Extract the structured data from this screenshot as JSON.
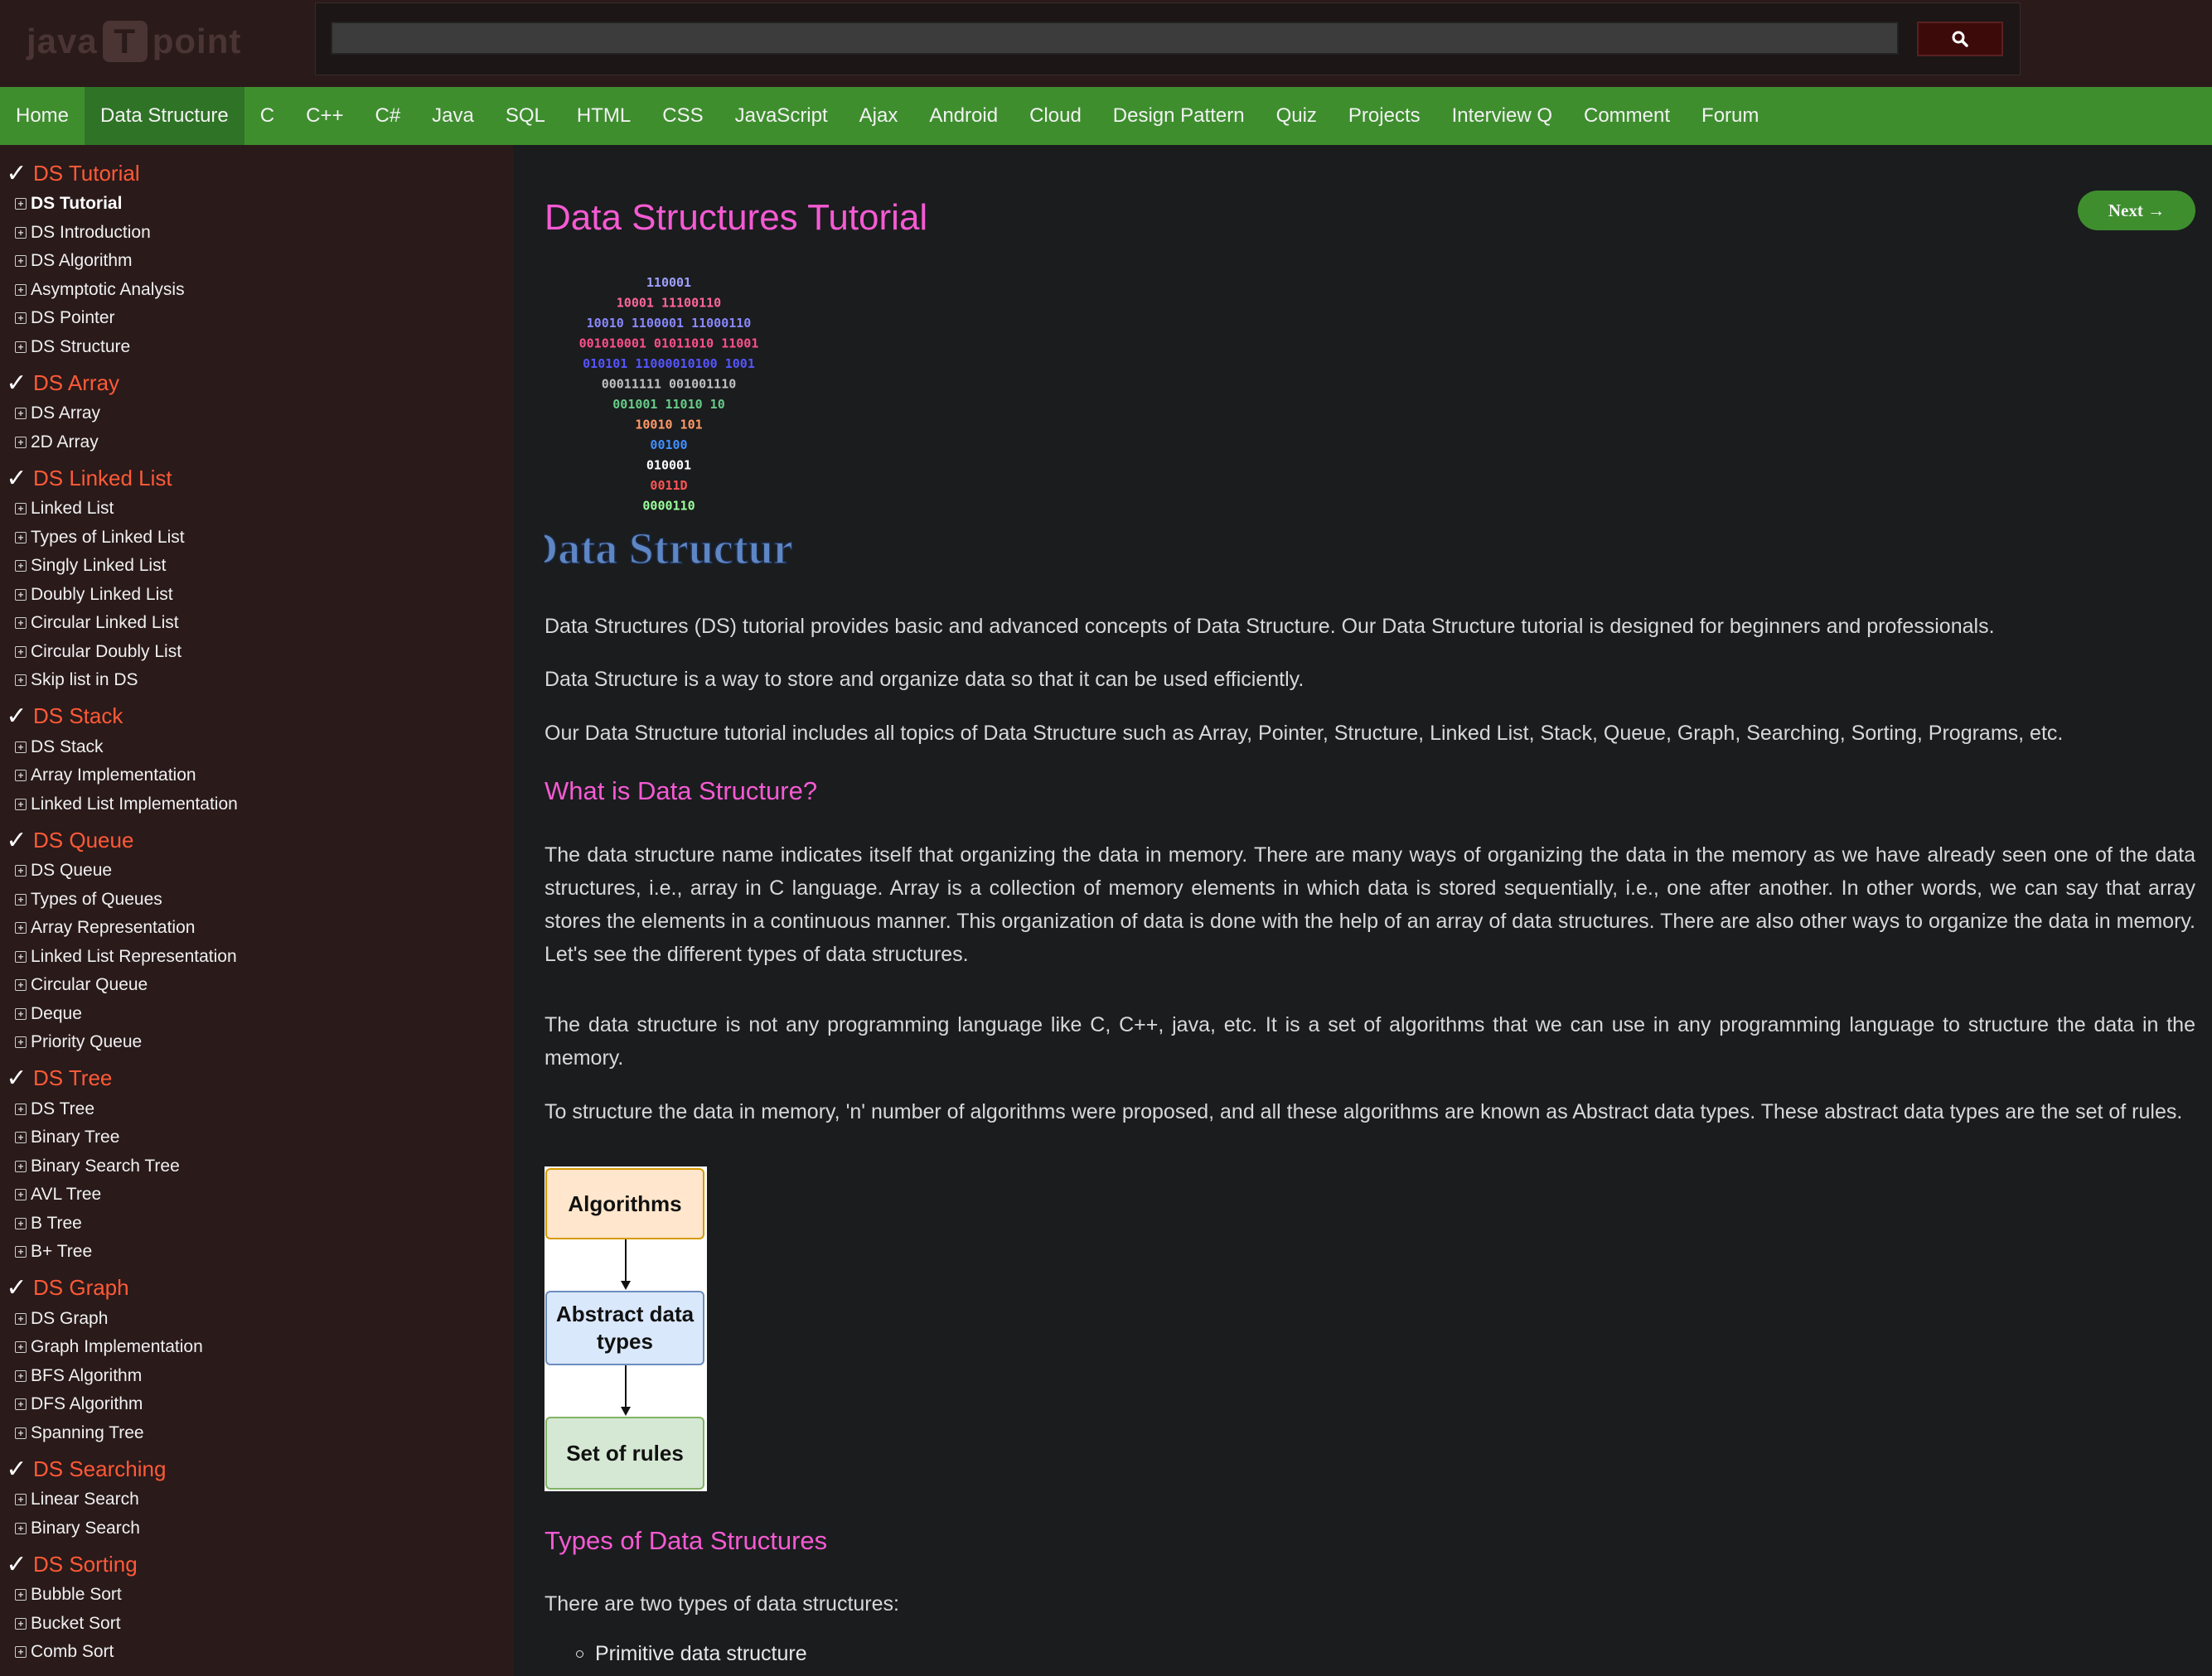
{
  "header": {
    "logo_left": "java",
    "logo_mark": "T",
    "logo_right": "point",
    "search_value": "",
    "search_icon": "search-icon"
  },
  "nav": {
    "items": [
      "Home",
      "Data Structure",
      "C",
      "C++",
      "C#",
      "Java",
      "SQL",
      "HTML",
      "CSS",
      "JavaScript",
      "Ajax",
      "Android",
      "Cloud",
      "Design Pattern",
      "Quiz",
      "Projects",
      "Interview Q",
      "Comment",
      "Forum"
    ],
    "active": "Data Structure",
    "bar_color": "#3e8e2e"
  },
  "sidebar": {
    "sections": [
      {
        "title": "DS Tutorial",
        "links": [
          "DS Tutorial",
          "DS Introduction",
          "DS Algorithm",
          "Asymptotic Analysis",
          "DS Pointer",
          "DS Structure"
        ]
      },
      {
        "title": "DS Array",
        "links": [
          "DS Array",
          "2D Array"
        ]
      },
      {
        "title": "DS Linked List",
        "links": [
          "Linked List",
          "Types of Linked List",
          "Singly Linked List",
          "Doubly Linked List",
          "Circular Linked List",
          "Circular Doubly List",
          "Skip list in DS"
        ]
      },
      {
        "title": "DS Stack",
        "links": [
          "DS Stack",
          "Array Implementation",
          "Linked List Implementation"
        ]
      },
      {
        "title": "DS Queue",
        "links": [
          "DS Queue",
          "Types of Queues",
          "Array Representation",
          "Linked List Representation",
          "Circular Queue",
          "Deque",
          "Priority Queue"
        ]
      },
      {
        "title": "DS Tree",
        "links": [
          "DS Tree",
          "Binary Tree",
          "Binary Search Tree",
          "AVL Tree",
          "B Tree",
          "B+ Tree"
        ]
      },
      {
        "title": "DS Graph",
        "links": [
          "DS Graph",
          "Graph Implementation",
          "BFS Algorithm",
          "DFS Algorithm",
          "Spanning Tree"
        ]
      },
      {
        "title": "DS Searching",
        "links": [
          "Linear Search",
          "Binary Search"
        ]
      },
      {
        "title": "DS Sorting",
        "links": [
          "Bubble Sort",
          "Bucket Sort",
          "Comb Sort"
        ]
      }
    ],
    "current_link": "DS Tutorial",
    "section_color": "#ff5a37"
  },
  "main": {
    "title": "Data Structures Tutorial",
    "next_label": "Next →",
    "logo_caption": "Data Structure",
    "binary_rows": [
      "110001",
      "10001 11100110",
      "10010 1100001 11000110",
      "001010001 01011010 11001",
      "010101 11000010100 1001",
      "00011111 001001110",
      "001001 11010 10",
      "10010 101",
      "00100",
      "010001",
      "0011D",
      "0000110"
    ],
    "intro_paragraphs": [
      "Data Structures (DS) tutorial provides basic and advanced concepts of Data Structure. Our Data Structure tutorial is designed for beginners and professionals.",
      "Data Structure is a way to store and organize data so that it can be used efficiently.",
      "Our Data Structure tutorial includes all topics of Data Structure such as Array, Pointer, Structure, Linked List, Stack, Queue, Graph, Searching, Sorting, Programs, etc."
    ],
    "heading_what": "What is Data Structure?",
    "what_paragraphs": [
      "The data structure name indicates itself that organizing the data in memory. There are many ways of organizing the data in the memory as we have already seen one of the data structures, i.e., array in C language. Array is a collection of memory elements in which data is stored sequentially, i.e., one after another. In other words, we can say that array stores the elements in a continuous manner. This organization of data is done with the help of an array of data structures. There are also other ways to organize the data in memory. Let's see the different types of data structures.",
      "The data structure is not any programming language like C, C++, java, etc. It is a set of algorithms that we can use in any programming language to structure the data in the memory.",
      "To structure the data in memory, 'n' number of algorithms were proposed, and all these algorithms are known as Abstract data types. These abstract data types are the set of rules."
    ],
    "flow": {
      "box1": "Algorithms",
      "box2": "Abstract data types",
      "box3": "Set of rules",
      "box1_color": "#ffe6cc",
      "box2_color": "#dae8fc",
      "box3_color": "#d5e8d4"
    },
    "heading_types": "Types of Data Structures",
    "types_intro": "There are two types of data structures:",
    "types_list": [
      "Primitive data structure"
    ]
  }
}
